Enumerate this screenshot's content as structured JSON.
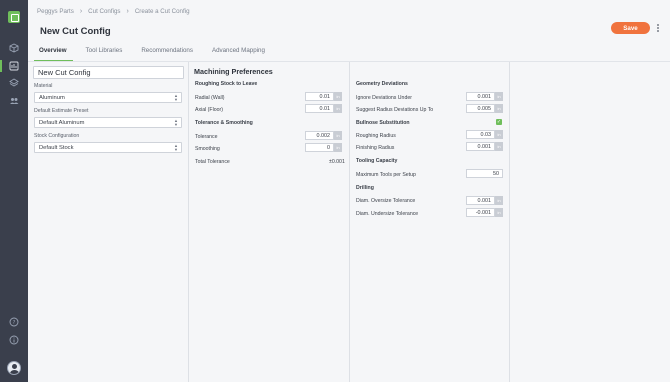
{
  "breadcrumb": [
    "Peggys Parts",
    "Cut Configs",
    "Create a Cut Config"
  ],
  "page_title": "New Cut Config",
  "save_label": "Save",
  "tabs": [
    {
      "label": "Overview",
      "active": true
    },
    {
      "label": "Tool Libraries",
      "active": false
    },
    {
      "label": "Recommendations",
      "active": false
    },
    {
      "label": "Advanced Mapping",
      "active": false
    }
  ],
  "left_panel": {
    "name_value": "New Cut Config",
    "material_label": "Material",
    "material_value": "Aluminum",
    "estimate_label": "Default Estimate Preset",
    "estimate_value": "Default Aluminum",
    "stock_label": "Stock Configuration",
    "stock_value": "Default Stock"
  },
  "machining": {
    "title": "Machining Preferences",
    "roughing_title": "Roughing Stock to Leave",
    "radial_label": "Radial (Wall)",
    "radial_value": "0.01",
    "axial_label": "Axial (Floor)",
    "axial_value": "0.01",
    "tolerance_title": "Tolerance & Smoothing",
    "tolerance_label": "Tolerance",
    "tolerance_value": "0.002",
    "smoothing_label": "Smoothing",
    "smoothing_value": "0",
    "total_label": "Total Tolerance",
    "total_value": "±0.001",
    "unit": "in"
  },
  "geometry": {
    "title": "Geometry Deviations",
    "ignore_label": "Ignore Deviations Under",
    "ignore_value": "0.001",
    "suggest_label": "Suggest Radius Deviations Up To",
    "suggest_value": "0.005",
    "bullnose_label": "Bullnose Substitution",
    "bullnose_checked": true,
    "roughing_radius_label": "Roughing Radius",
    "roughing_radius_value": "0.03",
    "finishing_radius_label": "Finishing Radius",
    "finishing_radius_value": "0.001",
    "tooling_title": "Tooling Capacity",
    "max_tools_label": "Maximum Tools per Setup",
    "max_tools_value": "50",
    "drilling_title": "Drilling",
    "oversize_label": "Diam. Oversize Tolerance",
    "oversize_value": "0.001",
    "undersize_label": "Diam. Undersize Tolerance",
    "undersize_value": "-0.001",
    "unit": "in"
  },
  "colors": {
    "sidebar": "#3a3f4c",
    "accent_green": "#6fbe5b",
    "save_orange": "#f0733e"
  },
  "icons": [
    "logo-icon",
    "cube-icon",
    "cut-config-icon",
    "layers-icon",
    "users-icon",
    "help-icon",
    "info-icon",
    "avatar"
  ]
}
